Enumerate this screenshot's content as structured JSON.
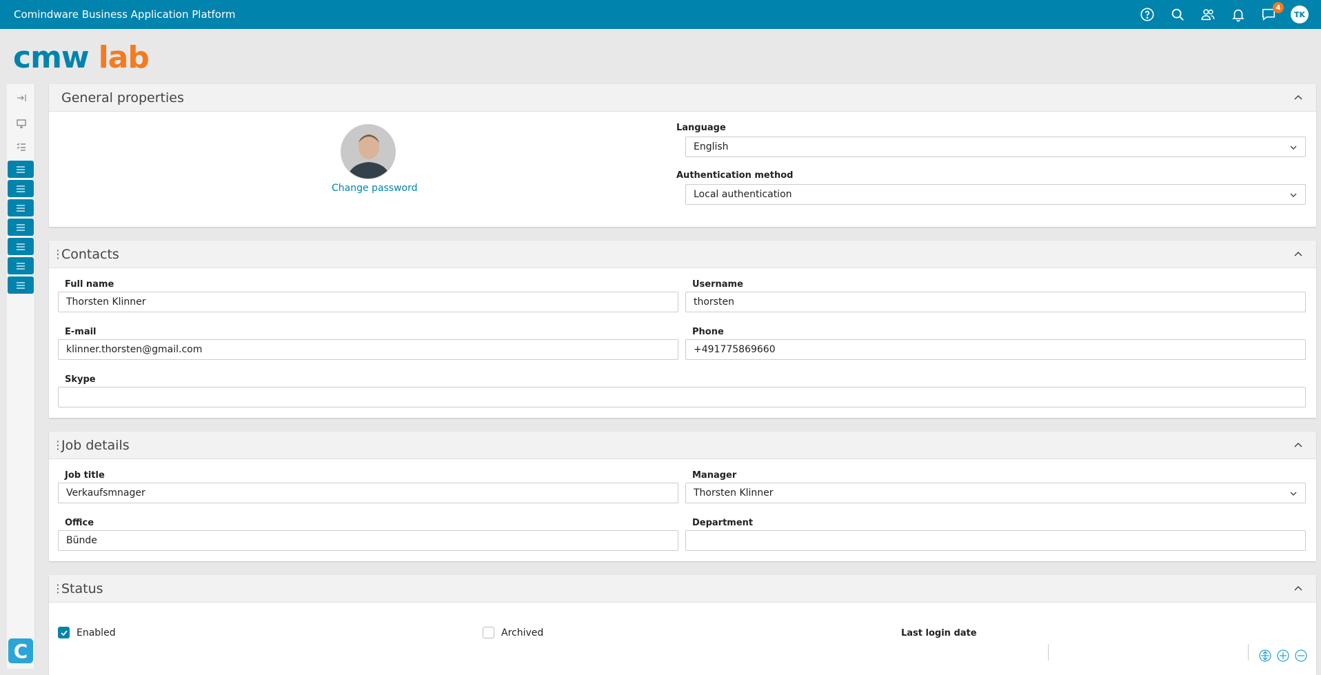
{
  "app": {
    "title": "Comindware Business Application Platform"
  },
  "topbar": {
    "icons": [
      "help-icon",
      "search-icon",
      "users-icon",
      "bell-icon",
      "chat-icon"
    ],
    "chat_badge": "4",
    "user_initials": "TK"
  },
  "logo": {
    "part1": "cmw",
    "part2": "lab"
  },
  "sections": {
    "general": {
      "title": "General properties",
      "change_password": "Change password",
      "language_label": "Language",
      "language_value": "English",
      "auth_label": "Authentication method",
      "auth_value": "Local authentication"
    },
    "contacts": {
      "title": "Contacts",
      "fullname_label": "Full name",
      "fullname_value": "Thorsten Klinner",
      "username_label": "Username",
      "username_value": "thorsten",
      "email_label": "E-mail",
      "email_value": "klinner.thorsten@gmail.com",
      "phone_label": "Phone",
      "phone_value": "+491775869660",
      "skype_label": "Skype",
      "skype_value": ""
    },
    "job": {
      "title": "Job details",
      "jobtitle_label": "Job title",
      "jobtitle_value": "Verkaufsmnager",
      "manager_label": "Manager",
      "manager_value": "Thorsten Klinner",
      "office_label": "Office",
      "office_value": "Bünde",
      "department_label": "Department",
      "department_value": ""
    },
    "status": {
      "title": "Status",
      "enabled_label": "Enabled",
      "enabled_checked": true,
      "archived_label": "Archived",
      "archived_checked": false,
      "lastlogin_label": "Last login date"
    }
  },
  "colors": {
    "brand": "#0083ad",
    "accent": "#f47b20"
  }
}
